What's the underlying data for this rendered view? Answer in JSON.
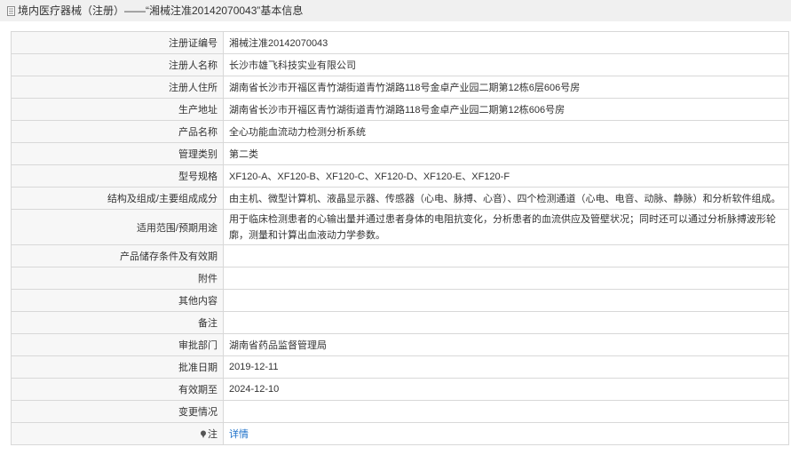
{
  "header": {
    "title": "境内医疗器械（注册）——“湘械注准20142070043”基本信息"
  },
  "rows": [
    {
      "label": "注册证编号",
      "value": "湘械注准20142070043"
    },
    {
      "label": "注册人名称",
      "value": "长沙市雄飞科技实业有限公司"
    },
    {
      "label": "注册人住所",
      "value": "湖南省长沙市开福区青竹湖街道青竹湖路118号金卓产业园二期第12栋6层606号房"
    },
    {
      "label": "生产地址",
      "value": "湖南省长沙市开福区青竹湖街道青竹湖路118号金卓产业园二期第12栋606号房"
    },
    {
      "label": "产品名称",
      "value": "全心功能血流动力检测分析系统"
    },
    {
      "label": "管理类别",
      "value": "第二类"
    },
    {
      "label": "型号规格",
      "value": "XF120-A、XF120-B、XF120-C、XF120-D、XF120-E、XF120-F"
    },
    {
      "label": "结构及组成/主要组成成分",
      "value": "由主机、微型计算机、液晶显示器、传感器（心电、脉搏、心音）、四个检测通道（心电、电音、动脉、静脉）和分析软件组成。"
    },
    {
      "label": "适用范围/预期用途",
      "value": "用于临床检测患者的心输出量并通过患者身体的电阻抗变化，分析患者的血流供应及管壁状况；同时还可以通过分析脉搏波形轮廓，测量和计算出血液动力学参数。"
    },
    {
      "label": "产品储存条件及有效期",
      "value": ""
    },
    {
      "label": "附件",
      "value": ""
    },
    {
      "label": "其他内容",
      "value": ""
    },
    {
      "label": "备注",
      "value": ""
    },
    {
      "label": "审批部门",
      "value": "湖南省药品监督管理局"
    },
    {
      "label": "批准日期",
      "value": "2019-12-11"
    },
    {
      "label": "有效期至",
      "value": "2024-12-10"
    },
    {
      "label": "变更情况",
      "value": ""
    }
  ],
  "note": {
    "label": "注",
    "link_text": "详情",
    "icon": "pin-icon"
  }
}
